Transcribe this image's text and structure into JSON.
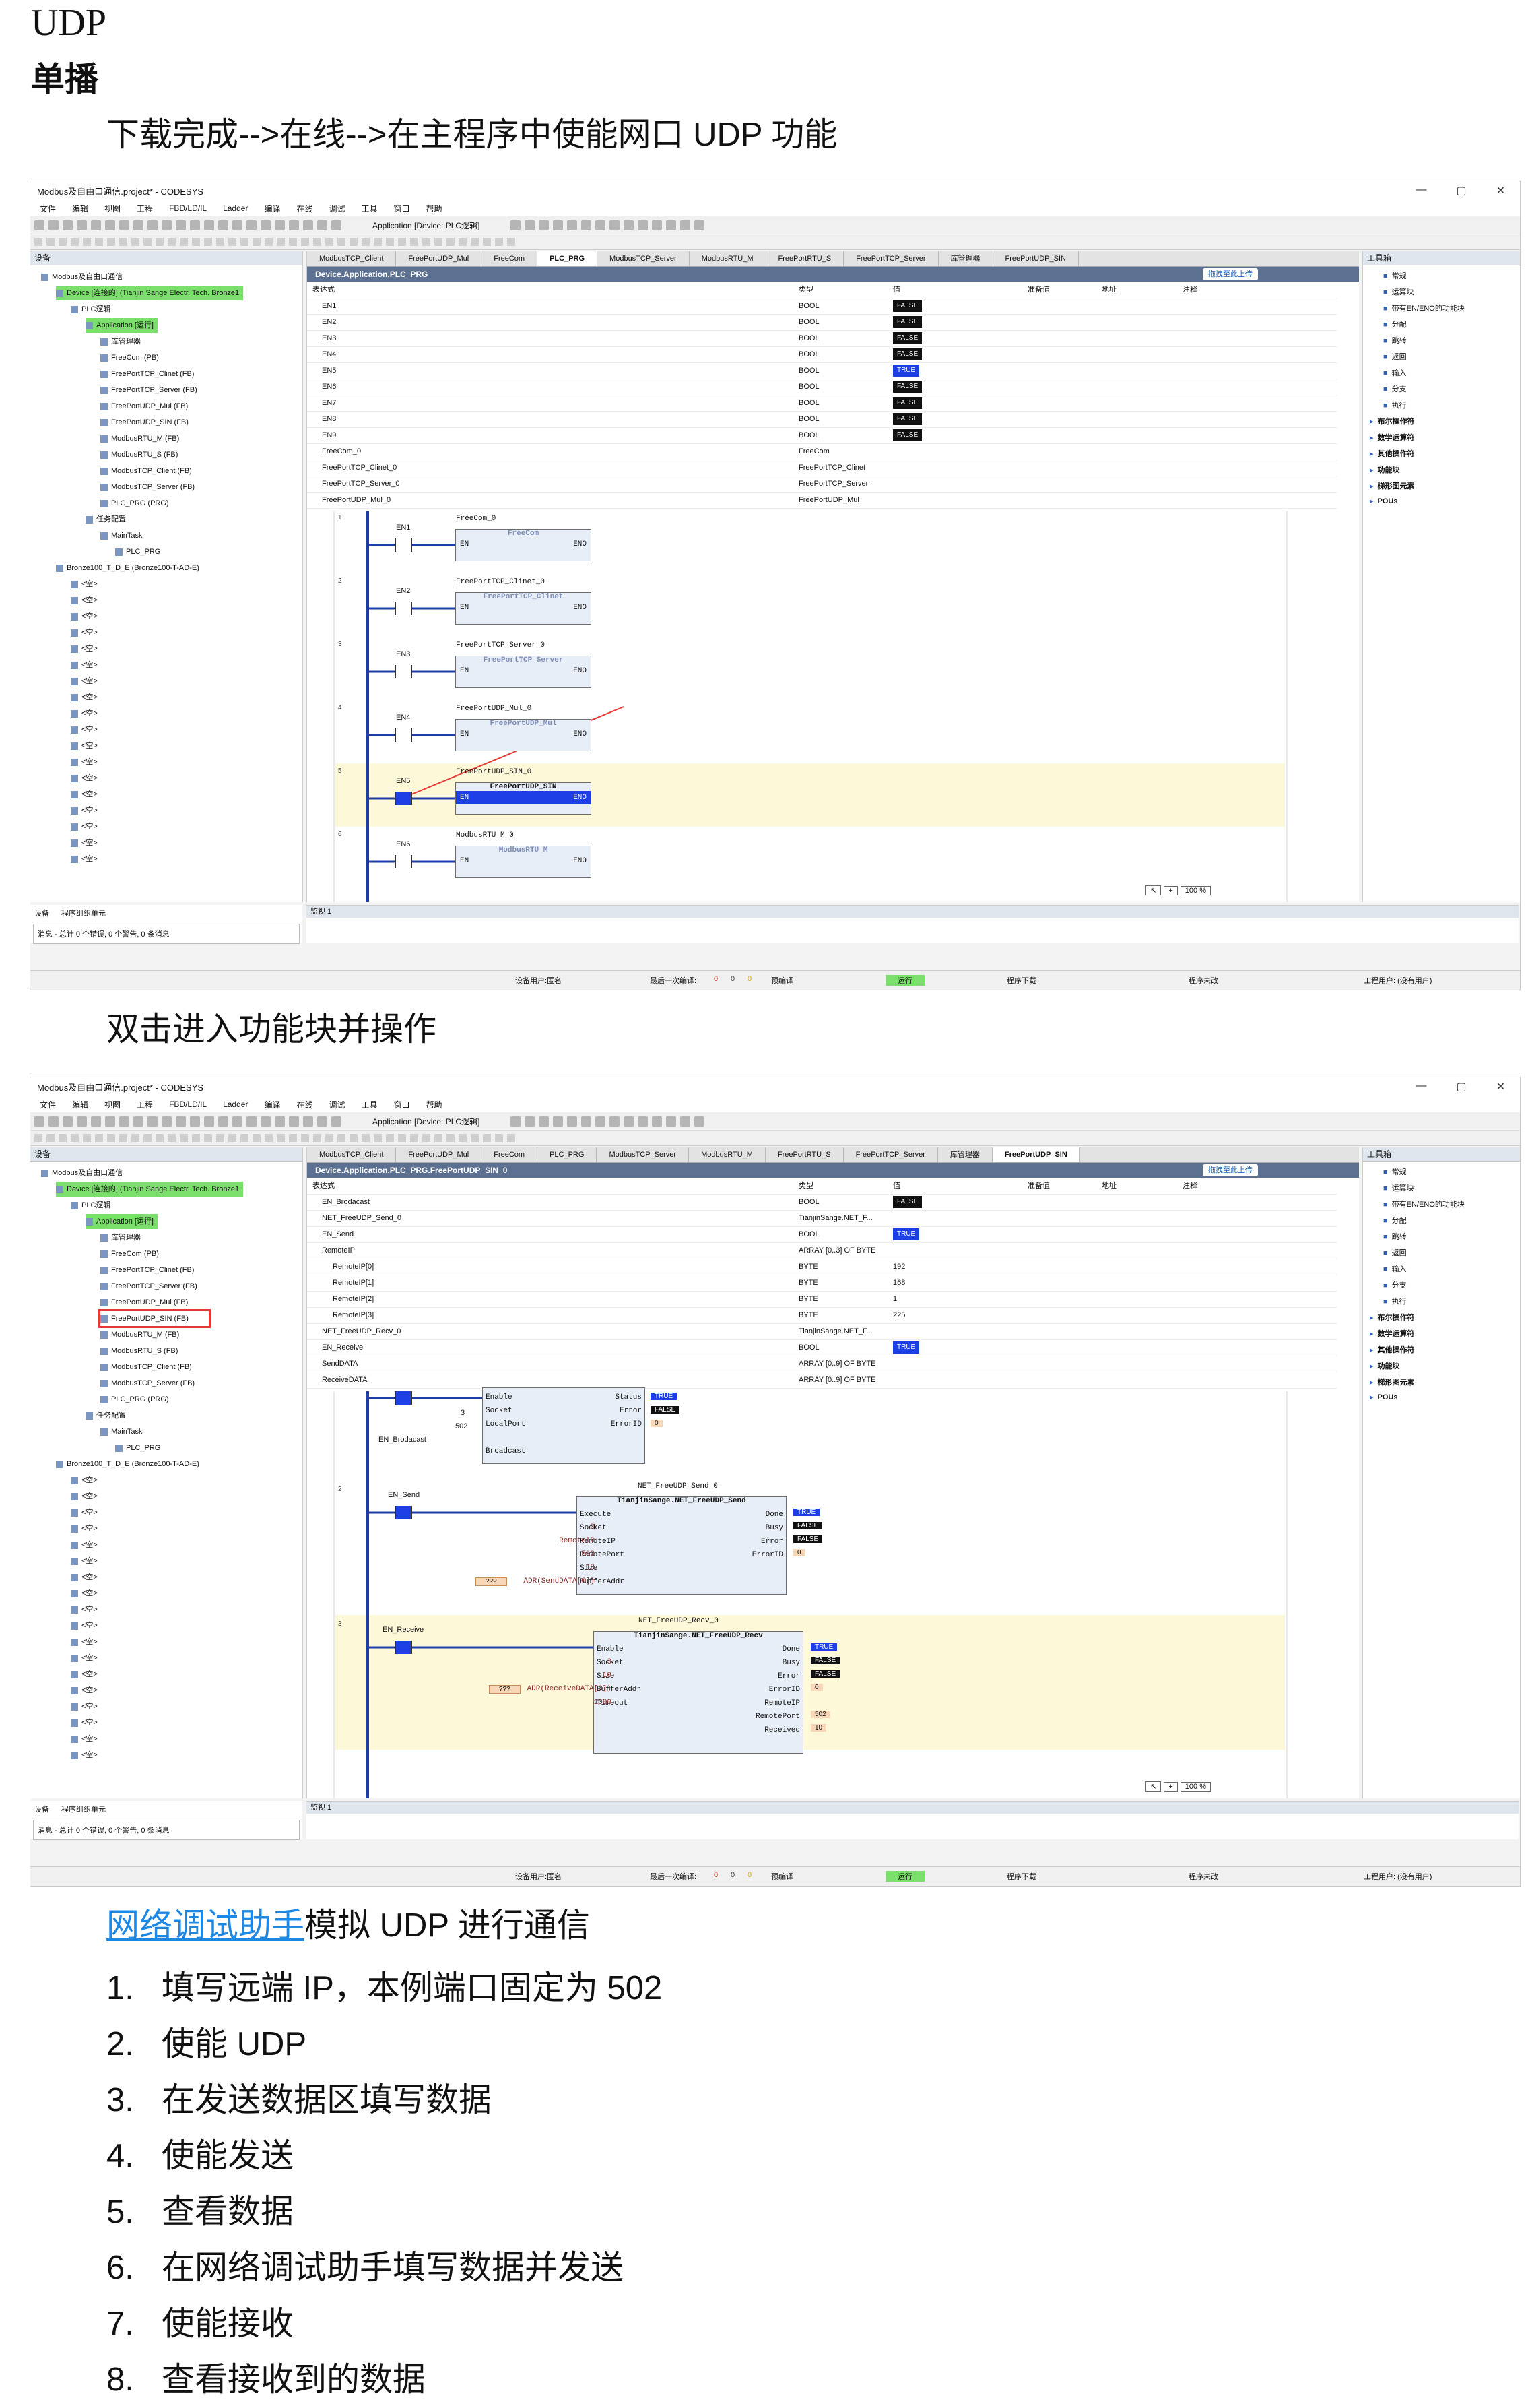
{
  "doc": {
    "title": "UDP",
    "subtitle": "单播",
    "para1": "下载完成-->在线-->在主程序中使能网口 UDP 功能",
    "para2": "双击进入功能块并操作",
    "para3_link": "网络调试助手",
    "para3_rest": "模拟 UDP 进行通信",
    "steps": [
      {
        "num": "1.",
        "text": "填写远端 IP，本例端口固定为 502"
      },
      {
        "num": "2.",
        "text": "使能 UDP"
      },
      {
        "num": "3.",
        "text": "在发送数据区填写数据"
      },
      {
        "num": "4.",
        "text": "使能发送"
      },
      {
        "num": "5.",
        "text": "查看数据"
      },
      {
        "num": "6.",
        "text": "在网络调试助手填写数据并发送"
      },
      {
        "num": "7.",
        "text": "使能接收"
      },
      {
        "num": "8.",
        "text": "查看接收到的数据"
      }
    ]
  },
  "ide": {
    "window_title": "Modbus及自由口通信.project* - CODESYS",
    "menu": [
      "文件",
      "编辑",
      "视图",
      "工程",
      "FBD/LD/IL",
      "Ladder",
      "编译",
      "在线",
      "调试",
      "工具",
      "窗口",
      "帮助"
    ],
    "device_combo": "Application [Device: PLC逻辑]",
    "left_pane_title": "设备",
    "right_pane_title": "工具箱",
    "upload_label": "拖拽至此上传",
    "tree": [
      {
        "indent": 0,
        "label": "Modbus及自由口通信"
      },
      {
        "indent": 1,
        "label": "Device [连接的] (Tianjin Sange Electr. Tech. Bronze1",
        "sel": true
      },
      {
        "indent": 2,
        "label": "PLC逻辑"
      },
      {
        "indent": 3,
        "label": "Application [运行]",
        "sel": true
      },
      {
        "indent": 4,
        "label": "库管理器"
      },
      {
        "indent": 4,
        "label": "FreeCom (PB)"
      },
      {
        "indent": 4,
        "label": "FreePortTCP_Clinet (FB)"
      },
      {
        "indent": 4,
        "label": "FreePortTCP_Server (FB)"
      },
      {
        "indent": 4,
        "label": "FreePortUDP_Mul (FB)"
      },
      {
        "indent": 4,
        "label": "FreePortUDP_SIN (FB)"
      },
      {
        "indent": 4,
        "label": "ModbusRTU_M (FB)"
      },
      {
        "indent": 4,
        "label": "ModbusRTU_S (FB)"
      },
      {
        "indent": 4,
        "label": "ModbusTCP_Client (FB)"
      },
      {
        "indent": 4,
        "label": "ModbusTCP_Server (FB)"
      },
      {
        "indent": 4,
        "label": "PLC_PRG (PRG)"
      },
      {
        "indent": 3,
        "label": "任务配置"
      },
      {
        "indent": 4,
        "label": "MainTask"
      },
      {
        "indent": 5,
        "label": "PLC_PRG"
      },
      {
        "indent": 1,
        "label": "Bronze100_T_D_E (Bronze100-T-AD-E)"
      },
      {
        "indent": 2,
        "label": "<空>"
      },
      {
        "indent": 2,
        "label": "<空>"
      },
      {
        "indent": 2,
        "label": "<空>"
      },
      {
        "indent": 2,
        "label": "<空>"
      },
      {
        "indent": 2,
        "label": "<空>"
      },
      {
        "indent": 2,
        "label": "<空>"
      },
      {
        "indent": 2,
        "label": "<空>"
      },
      {
        "indent": 2,
        "label": "<空>"
      },
      {
        "indent": 2,
        "label": "<空>"
      },
      {
        "indent": 2,
        "label": "<空>"
      },
      {
        "indent": 2,
        "label": "<空>"
      },
      {
        "indent": 2,
        "label": "<空>"
      },
      {
        "indent": 2,
        "label": "<空>"
      },
      {
        "indent": 2,
        "label": "<空>"
      },
      {
        "indent": 2,
        "label": "<空>"
      },
      {
        "indent": 2,
        "label": "<空>"
      },
      {
        "indent": 2,
        "label": "<空>"
      },
      {
        "indent": 2,
        "label": "<空>"
      }
    ],
    "tabs": [
      "ModbusTCP_Client",
      "FreePortUDP_Mul",
      "FreeCom",
      "PLC_PRG",
      "ModbusTCP_Server",
      "ModbusRTU_M",
      "FreePortRTU_S",
      "FreePortTCP_Server",
      "库管理器",
      "FreePortUDP_SIN"
    ],
    "table_headers": [
      "表达式",
      "类型",
      "值",
      "准备值",
      "地址",
      "注释"
    ],
    "toolbox": [
      "常规",
      "运算块",
      "带有EN/ENO的功能块",
      "分配",
      "跳转",
      "返回",
      "输入",
      "分支",
      "执行",
      "布尔操作符",
      "数学运算符",
      "其他操作符",
      "功能块",
      "梯形图元素",
      "POUs"
    ],
    "watch_title": "监视 1",
    "msg_tabs": [
      "设备",
      "程序组织单元"
    ],
    "msg_line": "消息 - 总计 0 个错误, 0 个警告, 0 条消息",
    "status": [
      "设备用户:匿名",
      "最后一次编译:",
      "0",
      "0",
      "0",
      "预编译",
      "运行",
      "程序下载",
      "程序未改",
      "工程用户: (没有用户)"
    ],
    "zoom": "100 %"
  },
  "shot1": {
    "path": "Device.Application.PLC_PRG",
    "rows": [
      {
        "expr": "EN1",
        "type": "BOOL",
        "val": "FALSE"
      },
      {
        "expr": "EN2",
        "type": "BOOL",
        "val": "FALSE"
      },
      {
        "expr": "EN3",
        "type": "BOOL",
        "val": "FALSE"
      },
      {
        "expr": "EN4",
        "type": "BOOL",
        "val": "FALSE"
      },
      {
        "expr": "EN5",
        "type": "BOOL",
        "val": "TRUE"
      },
      {
        "expr": "EN6",
        "type": "BOOL",
        "val": "FALSE"
      },
      {
        "expr": "EN7",
        "type": "BOOL",
        "val": "FALSE"
      },
      {
        "expr": "EN8",
        "type": "BOOL",
        "val": "FALSE"
      },
      {
        "expr": "EN9",
        "type": "BOOL",
        "val": "FALSE"
      },
      {
        "expr": "FreeCom_0",
        "type": "FreeCom",
        "val": ""
      },
      {
        "expr": "FreePortTCP_Clinet_0",
        "type": "FreePortTCP_Clinet",
        "val": ""
      },
      {
        "expr": "FreePortTCP_Server_0",
        "type": "FreePortTCP_Server",
        "val": ""
      },
      {
        "expr": "FreePortUDP_Mul_0",
        "type": "FreePortUDP_Mul",
        "val": ""
      }
    ],
    "networks": [
      {
        "num": "1",
        "contact": "EN1",
        "inst": "FreeCom_0",
        "type": "FreeCom"
      },
      {
        "num": "2",
        "contact": "EN2",
        "inst": "FreePortTCP_Clinet_0",
        "type": "FreePortTCP_Clinet"
      },
      {
        "num": "3",
        "contact": "EN3",
        "inst": "FreePortTCP_Server_0",
        "type": "FreePortTCP_Server"
      },
      {
        "num": "4",
        "contact": "EN4",
        "inst": "FreePortUDP_Mul_0",
        "type": "FreePortUDP_Mul"
      },
      {
        "num": "5",
        "contact": "EN5",
        "inst": "FreePortUDP_SIN_0",
        "type": "FreePortUDP_SIN"
      },
      {
        "num": "6",
        "contact": "EN6",
        "inst": "ModbusRTU_M_0",
        "type": "ModbusRTU_M"
      }
    ],
    "pin_en": "EN",
    "pin_eno": "ENO"
  },
  "shot2": {
    "path": "Device.Application.PLC_PRG.FreePortUDP_SIN_0",
    "rows": [
      {
        "expr": "EN_Brodacast",
        "type": "BOOL",
        "val": "FALSE"
      },
      {
        "expr": "NET_FreeUDP_Send_0",
        "type": "TianjinSange.NET_F...",
        "val": ""
      },
      {
        "expr": "EN_Send",
        "type": "BOOL",
        "val": "TRUE"
      },
      {
        "expr": "RemoteIP",
        "type": "ARRAY [0..3] OF BYTE",
        "val": ""
      },
      {
        "expr": "RemoteIP[0]",
        "type": "BYTE",
        "val": "192"
      },
      {
        "expr": "RemoteIP[1]",
        "type": "BYTE",
        "val": "168"
      },
      {
        "expr": "RemoteIP[2]",
        "type": "BYTE",
        "val": "1"
      },
      {
        "expr": "RemoteIP[3]",
        "type": "BYTE",
        "val": "225"
      },
      {
        "expr": "NET_FreeUDP_Recv_0",
        "type": "TianjinSange.NET_F...",
        "val": ""
      },
      {
        "expr": "EN_Receive",
        "type": "BOOL",
        "val": "TRUE"
      },
      {
        "expr": "SendDATA",
        "type": "ARRAY [0..9] OF BYTE",
        "val": ""
      },
      {
        "expr": "ReceiveDATA",
        "type": "ARRAY [0..9] OF BYTE",
        "val": ""
      }
    ],
    "net1": {
      "enable": "Enable",
      "socket": "Socket",
      "localport": "LocalPort",
      "status": "Status",
      "error": "Error",
      "errorid": "ErrorID",
      "v_socket": "3",
      "v_port": "502",
      "v_status": "TRUE",
      "v_error": "FALSE",
      "v_errorid": "0",
      "contact": "EN_Brodacast",
      "broadcast": "Broadcast"
    },
    "net2": {
      "num": "2",
      "inst": "NET_FreeUDP_Send_0",
      "type": "TianjinSange.NET_FreeUDP_Send",
      "contact": "EN_Send",
      "pins_in": [
        "Execute",
        "Socket",
        "RemoteIP",
        "RemotePort",
        "Size",
        "BufferAddr"
      ],
      "pins_out": [
        "Done",
        "Busy",
        "Error",
        "ErrorID"
      ],
      "v_in": [
        "",
        "3",
        "RemoteIP",
        "502",
        "10",
        "ADR(SendDATA[0])"
      ],
      "v_out": [
        "TRUE",
        "FALSE",
        "FALSE",
        "0"
      ],
      "q": "???"
    },
    "net3": {
      "num": "3",
      "inst": "NET_FreeUDP_Recv_0",
      "type": "TianjinSange.NET_FreeUDP_Recv",
      "contact": "EN_Receive",
      "pins_in": [
        "Enable",
        "Socket",
        "Size",
        "BufferAddr",
        "Timeout"
      ],
      "pins_out": [
        "Done",
        "Busy",
        "Error",
        "ErrorID",
        "RemoteIP",
        "RemotePort",
        "Received"
      ],
      "v_in": [
        "",
        "3",
        "10",
        "ADR(ReceiveDATA[0])",
        "1000"
      ],
      "v_out": [
        "TRUE",
        "FALSE",
        "FALSE",
        "0",
        "",
        "502",
        "10"
      ],
      "q": "???"
    }
  },
  "colors": {
    "false_bg": "#111111",
    "true_bg": "#1e3ee6",
    "path_bar": "#5c7191",
    "run_green": "#7be06b",
    "link": "#1e88e5",
    "highlight": "#e53935"
  }
}
